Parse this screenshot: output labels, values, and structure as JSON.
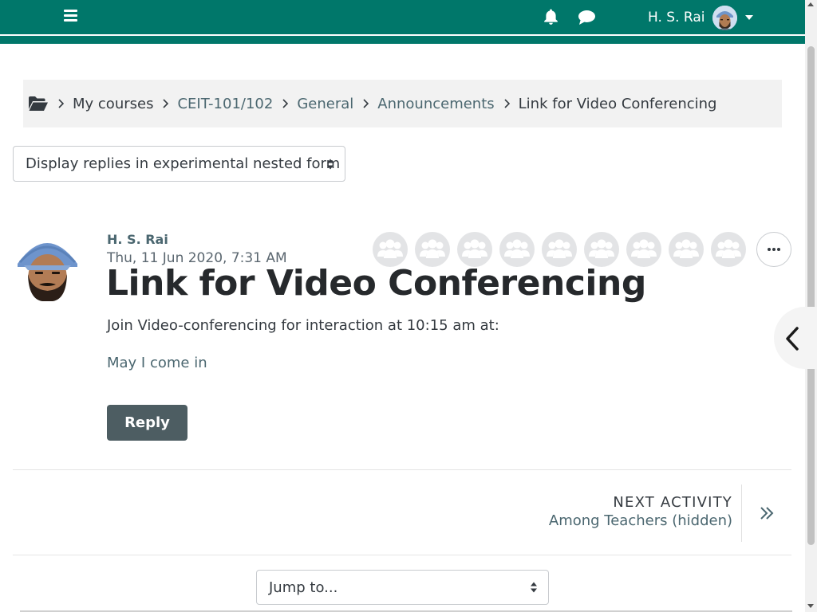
{
  "navbar": {
    "user_name": "H. S. Rai",
    "icons": [
      "menu-icon",
      "bell-icon",
      "chat-icon",
      "chevron-down-icon"
    ],
    "color": "#00776a"
  },
  "breadcrumb": {
    "items": [
      {
        "label": "My courses"
      },
      {
        "label": "CEIT-101/102"
      },
      {
        "label": "General"
      },
      {
        "label": "Announcements"
      },
      {
        "label": "Link for Video Conferencing"
      }
    ]
  },
  "display_mode": {
    "selected": "Display replies in experimental nested form"
  },
  "post": {
    "author": "H. S. Rai",
    "date": "Thu, 11 Jun 2020, 7:31 AM",
    "title": "Link for Video Conferencing",
    "body": "Join Video-conferencing for interaction at 10:15 am at:",
    "link_text": "May I come in",
    "reply_label": "Reply",
    "group_icon_count": 9,
    "more_label": "..."
  },
  "next_activity": {
    "heading": "NEXT ACTIVITY",
    "name": "Among Teachers (hidden)"
  },
  "jump": {
    "selected": "Jump to..."
  },
  "colors": {
    "brand": "#00776a",
    "reply_button": "#4d5d62",
    "link": "#4b6770"
  }
}
